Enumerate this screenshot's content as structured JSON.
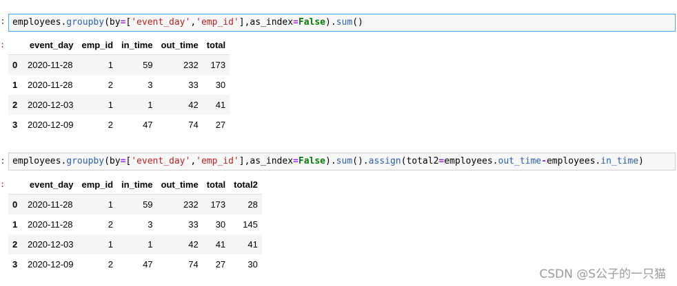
{
  "cells": [
    {
      "prompt_mark": ":",
      "output_mark": ":",
      "code_tokens": [
        {
          "t": "employees.",
          "c": ""
        },
        {
          "t": "groupby",
          "c": "fn"
        },
        {
          "t": "(by",
          "c": ""
        },
        {
          "t": "=",
          "c": "op"
        },
        {
          "t": "[",
          "c": ""
        },
        {
          "t": "'event_day'",
          "c": "str"
        },
        {
          "t": ",",
          "c": ""
        },
        {
          "t": "'emp_id'",
          "c": "str"
        },
        {
          "t": "],as_index",
          "c": ""
        },
        {
          "t": "=",
          "c": "op"
        },
        {
          "t": "False",
          "c": "kw"
        },
        {
          "t": ").",
          "c": ""
        },
        {
          "t": "sum",
          "c": "fn"
        },
        {
          "t": "()",
          "c": ""
        }
      ],
      "table": {
        "columns": [
          "",
          "event_day",
          "emp_id",
          "in_time",
          "out_time",
          "total"
        ],
        "rows": [
          [
            "0",
            "2020-11-28",
            "1",
            "59",
            "232",
            "173"
          ],
          [
            "1",
            "2020-11-28",
            "2",
            "3",
            "33",
            "30"
          ],
          [
            "2",
            "2020-12-03",
            "1",
            "1",
            "42",
            "41"
          ],
          [
            "3",
            "2020-12-09",
            "2",
            "47",
            "74",
            "27"
          ]
        ]
      }
    },
    {
      "prompt_mark": ":",
      "output_mark": ":",
      "code_tokens": [
        {
          "t": "employees.",
          "c": ""
        },
        {
          "t": "groupby",
          "c": "fn"
        },
        {
          "t": "(by",
          "c": ""
        },
        {
          "t": "=",
          "c": "op"
        },
        {
          "t": "[",
          "c": ""
        },
        {
          "t": "'event_day'",
          "c": "str"
        },
        {
          "t": ",",
          "c": ""
        },
        {
          "t": "'emp_id'",
          "c": "str"
        },
        {
          "t": "],as_index",
          "c": ""
        },
        {
          "t": "=",
          "c": "op"
        },
        {
          "t": "False",
          "c": "kw"
        },
        {
          "t": ").",
          "c": ""
        },
        {
          "t": "sum",
          "c": "fn"
        },
        {
          "t": "().",
          "c": ""
        },
        {
          "t": "assign",
          "c": "fn"
        },
        {
          "t": "(total2",
          "c": ""
        },
        {
          "t": "=",
          "c": "op"
        },
        {
          "t": "employees.",
          "c": ""
        },
        {
          "t": "out_time",
          "c": "fn"
        },
        {
          "t": "-",
          "c": "op"
        },
        {
          "t": "employees.",
          "c": ""
        },
        {
          "t": "in_time",
          "c": "fn"
        },
        {
          "t": ")",
          "c": ""
        }
      ],
      "table": {
        "columns": [
          "",
          "event_day",
          "emp_id",
          "in_time",
          "out_time",
          "total",
          "total2"
        ],
        "rows": [
          [
            "0",
            "2020-11-28",
            "1",
            "59",
            "232",
            "173",
            "28"
          ],
          [
            "1",
            "2020-11-28",
            "2",
            "3",
            "33",
            "30",
            "145"
          ],
          [
            "2",
            "2020-12-03",
            "1",
            "1",
            "42",
            "41",
            "41"
          ],
          [
            "3",
            "2020-12-09",
            "2",
            "47",
            "74",
            "27",
            "30"
          ]
        ]
      }
    }
  ],
  "watermark": "CSDN @S公子的一只猫"
}
